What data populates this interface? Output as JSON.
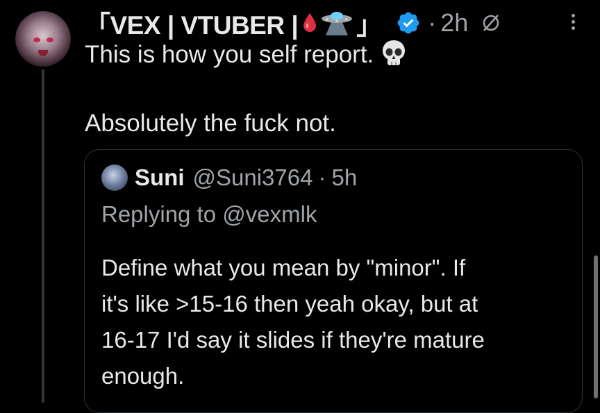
{
  "post": {
    "display_name_open": "「VEX | VTUBER |",
    "display_name_close": "」",
    "name_emojis": [
      "blood-drop",
      "ufo"
    ],
    "separator": "·",
    "time": "2h",
    "text_line1": "This is how you self report.",
    "text_line2": "Absolutely the fuck not."
  },
  "quoted": {
    "name": "Suni",
    "handle": "@Suni3764",
    "separator": "·",
    "time": "5h",
    "replying_to": "Replying to @vexmlk",
    "body_lines": [
      "Define what you mean by \"minor\". If",
      "it's like >15-16 then yeah okay, but at",
      "16-17 I'd say it slides if they're mature",
      "enough."
    ]
  },
  "colors": {
    "background": "#000000",
    "text_primary": "#e7e9ea",
    "text_secondary": "#a0a4a8",
    "verified_blue": "#1d9bf0",
    "border": "#2f3336"
  }
}
